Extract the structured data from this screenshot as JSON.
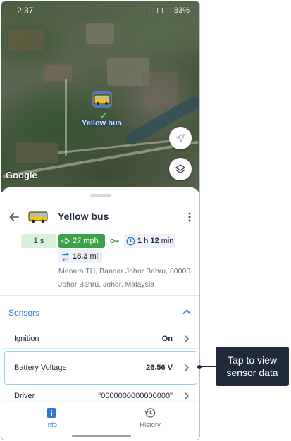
{
  "status_bar": {
    "time": "2:37",
    "battery": "83%"
  },
  "map": {
    "marker_label": "Yellow bus",
    "attribution": "Google",
    "buttons": {
      "locate_icon": "navigation-arrow-icon",
      "layers_icon": "layers-icon"
    }
  },
  "unit": {
    "name": "Yellow bus",
    "last_message": "1 s",
    "speed": "27 mph",
    "ignition_icon": "key-icon",
    "duration_h": "1",
    "duration_h_unit": "h",
    "duration_m": "12",
    "duration_m_unit": "min",
    "distance_value": "18.3",
    "distance_unit": "mi",
    "address_line1": "Menara TH, Bandar Johor Bahru, 80000",
    "address_line2": "Johor Bahru, Johor, Malaysia"
  },
  "sensors": {
    "title": "Sensors",
    "items": [
      {
        "label": "Ignition",
        "value": "On"
      },
      {
        "label": "Battery Voltage",
        "value": "26.56 V"
      },
      {
        "label": "Driver",
        "value": "\"0000000000000000\""
      }
    ]
  },
  "nav": {
    "info_label": "Info",
    "history_label": "History"
  },
  "callout": {
    "text": "Tap to view sensor data"
  },
  "colors": {
    "accent": "#2c78d4",
    "speed_chip": "#3ca24a",
    "time_chip": "#d9f0db",
    "highlight": "#8fd3ee",
    "callout_bg": "#1f2a3a"
  }
}
